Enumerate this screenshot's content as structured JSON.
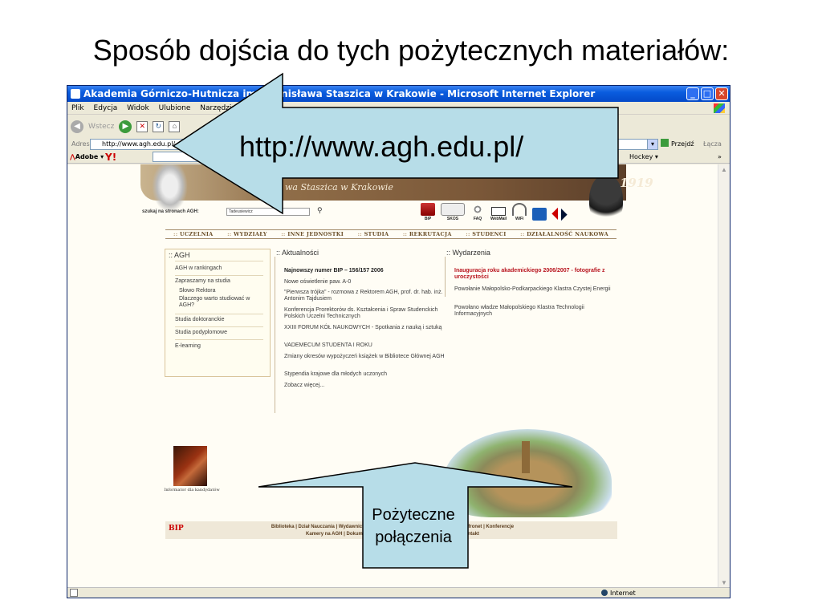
{
  "slide": {
    "title": "Sposób dojścia do tych pożytecznych materiałów:"
  },
  "browser": {
    "window_title": "Akademia Górniczo-Hutnicza im. Stanisława Staszica w Krakowie - Microsoft Internet Explorer",
    "menu": [
      "Plik",
      "Edycja",
      "Widok",
      "Ulubione",
      "Narzędzia",
      "Pomoc"
    ],
    "toolbar": {
      "back_label": "Wstecz"
    },
    "address": {
      "label": "Adres",
      "url": "http://www.agh.edu.pl/",
      "go_label": "Przejdź",
      "links_label": "Łącza"
    },
    "links_bar": {
      "adobe_label": "Adobe",
      "yahoo_label": "Y!",
      "hockey_label": "Hockey",
      "more": "»"
    },
    "status": {
      "zone": "Internet"
    }
  },
  "site": {
    "tagline": "wa Staszica w Krakowie",
    "year": "1919",
    "search_label": "szukaj na stronach AGH:",
    "search_value": "Tadeusiewicz",
    "quicklinks": [
      "BIP",
      "SKOS",
      "FAQ",
      "WebMail",
      "WiFi",
      "",
      ""
    ],
    "nav": [
      "UCZELNIA",
      "WYDZIAŁY",
      "INNE JEDNOSTKI",
      "STUDIA",
      "REKRUTACJA",
      "STUDENCI",
      "DZIAŁALNOŚĆ NAUKOWA"
    ],
    "agh": {
      "heading": ":: AGH",
      "items": [
        "AGH w rankingach",
        "Zapraszamy na studia",
        "Słowo Rektora",
        "Dlaczego warto studiować w AGH?",
        "Studia doktoranckie",
        "Studia podyplomowe",
        "E-learning"
      ]
    },
    "informator": "Informator dla kandydatów",
    "news": {
      "heading": ":: Aktualności",
      "items": [
        "Najnowszy numer BIP – 156/157 2006",
        "Nowe oświetlenie paw. A-0",
        "\"Pierwsza trójka\" - rozmowa z Rektorem AGH, prof. dr. hab. inż. Antonim Tajdusiem",
        "Konferencja Prorektorów ds. Kształcenia i Spraw Studenckich Polskich Uczelni Technicznych",
        "XXIII FORUM KÓŁ NAUKOWYCH - Spotkania z nauką i sztuką",
        "VADEMECUM STUDENTA I ROKU",
        "Zmiany okresów wypożyczeń książek w Bibliotece Głównej AGH",
        "Stypendia krajowe dla młodych uczonych",
        "Zobacz więcej..."
      ]
    },
    "events": {
      "heading": ":: Wydarzenia",
      "items": [
        "Inauguracja roku akademickiego 2006/2007 - fotografie z uroczystości",
        "Powołanie Małopolsko-Podkarpackiego Klastra Czystej Energii",
        "Powołano władze Małopolskiego Klastra Technologii Informacyjnych"
      ]
    },
    "footer": {
      "bip": "BIP",
      "line1": "Biblioteka | Dział Nauczania | Wydawnictwa | Stowarzyszenie Wychowanków | UCI | Cyfronet | Konferencje",
      "line2": "Kamery na AGH | Dokumenty | Pożyteczne połączenia | Newsletter | Kontakt"
    }
  },
  "callouts": {
    "url": "http://www.agh.edu.pl/",
    "useful_links": "Pożyteczne połączenia"
  },
  "colors": {
    "callout_fill": "#b7dde8",
    "title_bar": "#0a5ddf",
    "event_highlight": "#b8141e"
  }
}
